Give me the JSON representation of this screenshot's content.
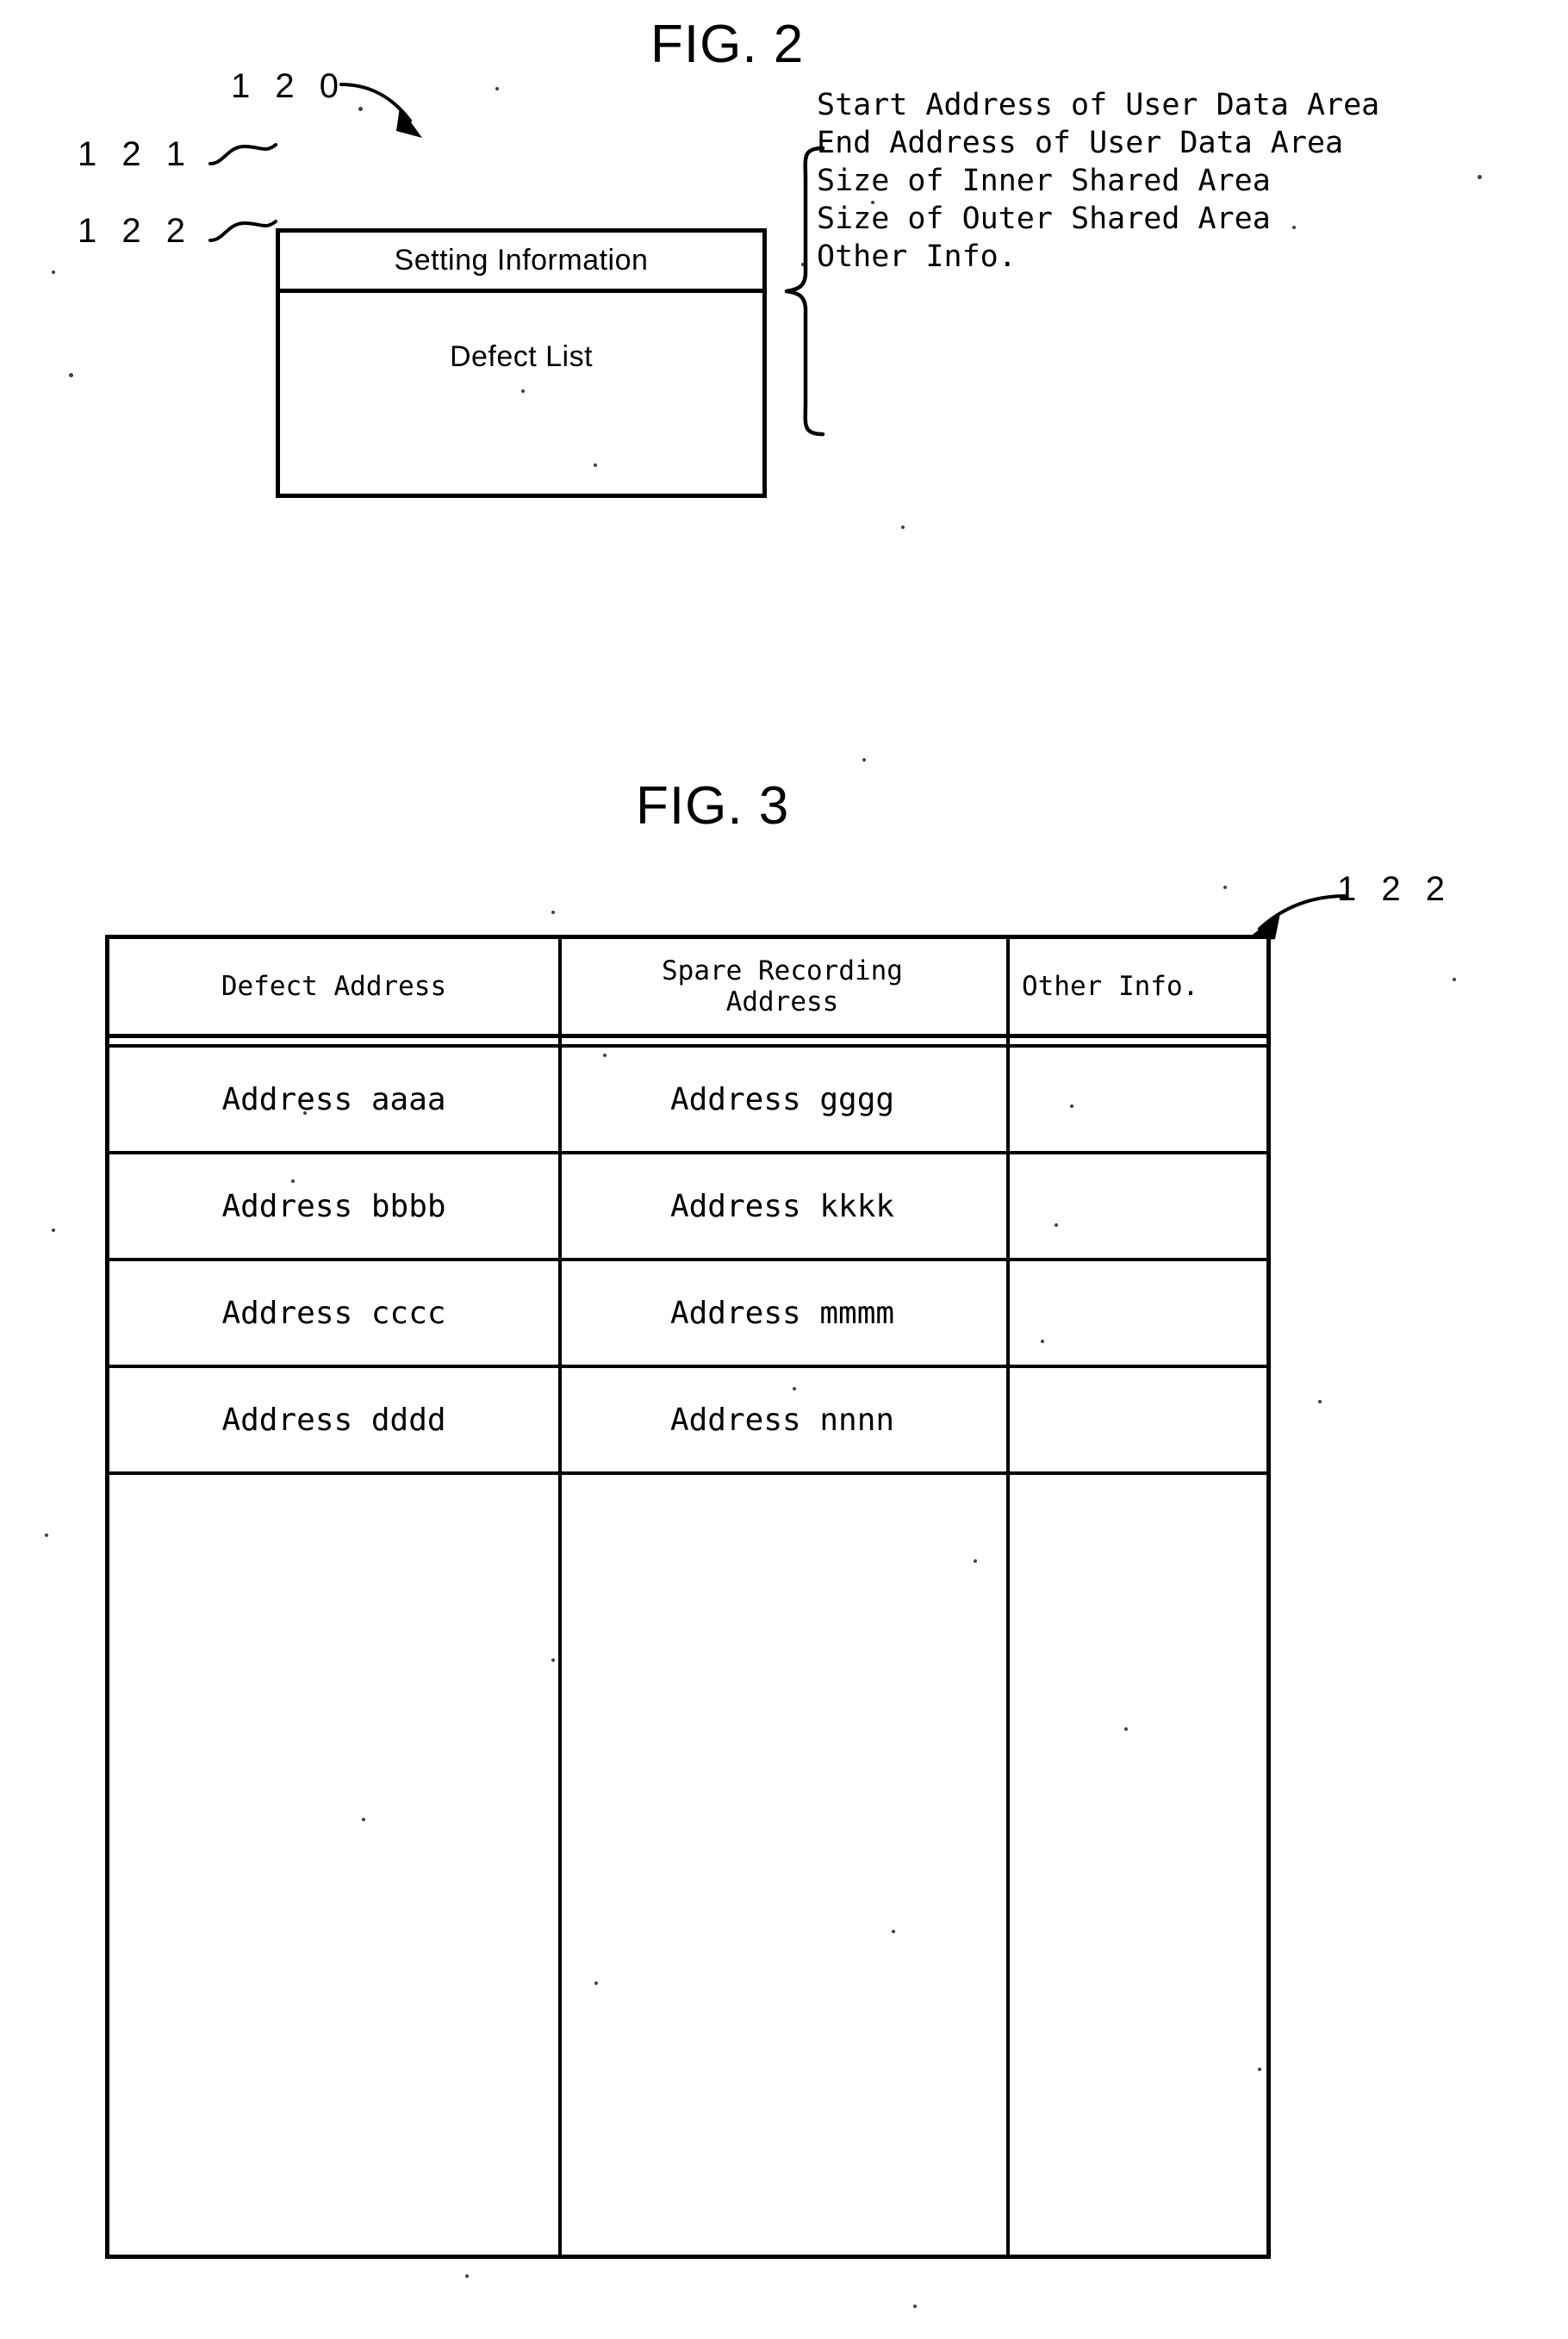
{
  "figure2": {
    "title": "FIG. 2",
    "ref_block": "1 2 0",
    "ref_setting": "1 2 1",
    "ref_defect": "1 2 2",
    "block": {
      "setting_information_label": "Setting Information",
      "defect_list_label": "Defect List"
    },
    "setting_information_items": [
      "Start Address of User Data Area",
      "End Address of User Data Area",
      "Size of Inner Shared Area",
      "Size of Outer Shared Area",
      "Other Info."
    ]
  },
  "figure3": {
    "title": "FIG. 3",
    "ref_table": "1 2 2",
    "table": {
      "headers": [
        "Defect Address",
        "Spare Recording\nAddress",
        "Other Info."
      ],
      "header_col1": "Defect Address",
      "header_col2_line1": "Spare Recording",
      "header_col2_line2": "Address",
      "header_col3": "Other Info.",
      "rows": [
        {
          "defect_address": "Address aaaa",
          "spare_recording_address": "Address gggg",
          "other_info": ""
        },
        {
          "defect_address": "Address bbbb",
          "spare_recording_address": "Address kkkk",
          "other_info": ""
        },
        {
          "defect_address": "Address cccc",
          "spare_recording_address": "Address mmmm",
          "other_info": ""
        },
        {
          "defect_address": "Address dddd",
          "spare_recording_address": "Address nnnn",
          "other_info": ""
        }
      ]
    }
  },
  "colors": {
    "ink": "#000000",
    "paper": "#ffffff"
  }
}
